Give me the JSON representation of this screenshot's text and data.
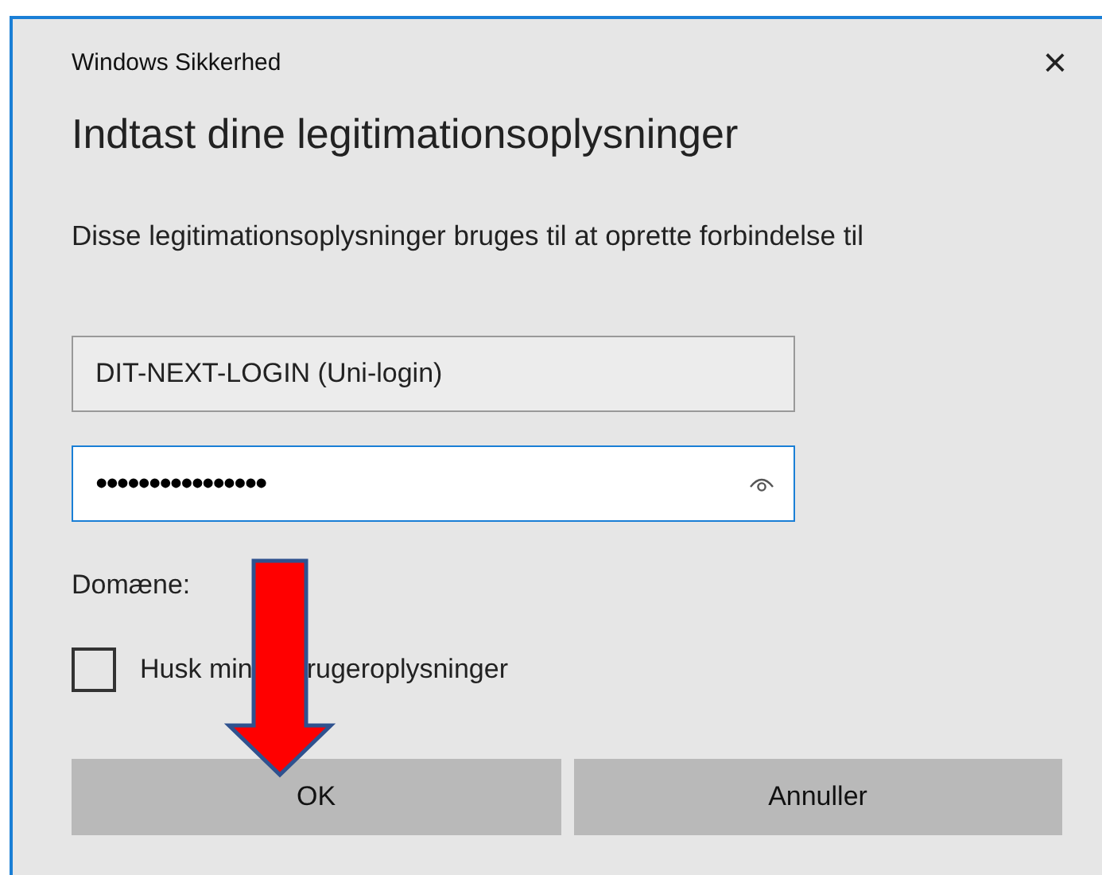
{
  "window": {
    "title": "Windows Sikkerhed",
    "close": "×"
  },
  "heading": "Indtast dine legitimationsoplysninger",
  "description": "Disse legitimationsoplysninger bruges til at oprette forbindelse til",
  "username": {
    "value": "DIT-NEXT-LOGIN (Uni-login)"
  },
  "password": {
    "value": "••••••••••••••••"
  },
  "domain_label": "Domæne:",
  "remember": {
    "label_parts": [
      "Husk min",
      "rugeroplysninger"
    ],
    "checked": false
  },
  "buttons": [
    {
      "label": "OK"
    },
    {
      "label": "Annuller"
    }
  ]
}
